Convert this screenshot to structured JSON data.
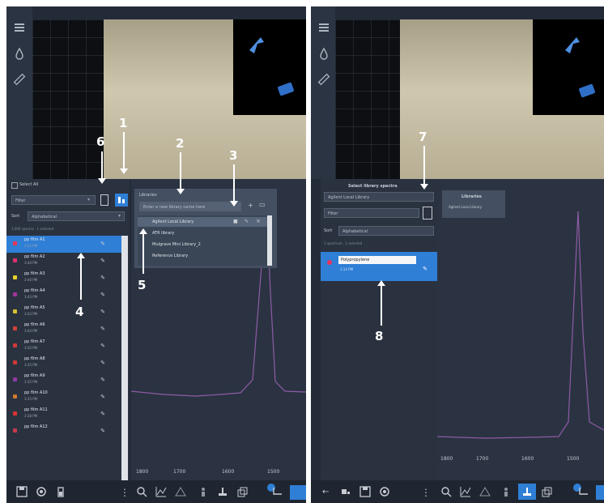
{
  "left": {
    "header_title": "Select All",
    "filter_placeholder": "Filter",
    "sort_label": "Sort",
    "sort_value": "Alphabetical",
    "count_text": "1,000 spectra · 1 selected",
    "items": [
      {
        "name": "pp film A1",
        "time": "3:32 PM",
        "color": "#e6345a"
      },
      {
        "name": "pp film A2",
        "time": "3:40 PM",
        "color": "#d9336d"
      },
      {
        "name": "pp film A3",
        "time": "3:40 PM",
        "color": "#e8d22b"
      },
      {
        "name": "pp film A4",
        "time": "3:43 PM",
        "color": "#a1359c"
      },
      {
        "name": "pp film A5",
        "time": "3:43 PM",
        "color": "#d9c133"
      },
      {
        "name": "pp film A6",
        "time": "3:44 PM",
        "color": "#d1423b"
      },
      {
        "name": "pp film A7",
        "time": "3:35 PM",
        "color": "#cd3b39"
      },
      {
        "name": "pp film A8",
        "time": "3:35 PM",
        "color": "#cb3a36"
      },
      {
        "name": "pp film A9",
        "time": "3:35 PM",
        "color": "#8e3aa5"
      },
      {
        "name": "pp film A10",
        "time": "3:35 PM",
        "color": "#d27a2d"
      },
      {
        "name": "pp film A11",
        "time": "3:38 PM",
        "color": "#d83333"
      },
      {
        "name": "pp film A12",
        "time": "",
        "color": "#c43b4a"
      }
    ],
    "libraries": {
      "title": "Libraries",
      "input_placeholder": "Enter a new library name here",
      "items": [
        "Agilent Local Library",
        "ATR library",
        "Mulgrave Mini Library_2",
        "Reference Library"
      ]
    },
    "axis_ticks": [
      "1800",
      "1700",
      "1600",
      "1500"
    ]
  },
  "right": {
    "header_title": "Select library spectra",
    "library_select": "Agilent Local Library",
    "filter_placeholder": "Filter",
    "sort_label": "Sort",
    "sort_value": "Alphabetical",
    "count_text": "1 spectrum · 1 selected",
    "item": {
      "name": "Polypropylene",
      "time": "1:14 PM",
      "color": "#e6345a"
    },
    "libraries_title": "Libraries",
    "libraries_item": "Agilent Local Library",
    "axis_ticks": [
      "1800",
      "1700",
      "1600",
      "1500"
    ]
  },
  "callouts": [
    "1",
    "2",
    "3",
    "4",
    "5",
    "6",
    "7",
    "8"
  ]
}
